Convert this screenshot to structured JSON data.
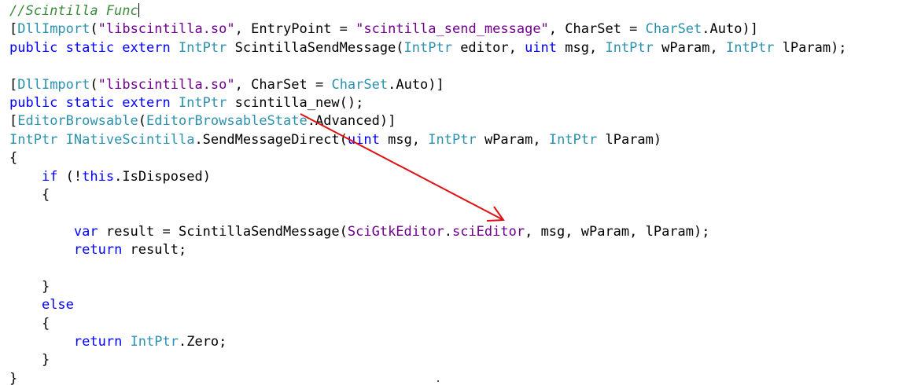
{
  "colors": {
    "comment": "#3a8a3a",
    "keyword": "#0000ff",
    "type": "#2b91af",
    "string": "#a31515",
    "member": "#6f008a",
    "plain": "#000000",
    "annotation_arrow": "#e01010"
  },
  "code_lines": [
    [
      {
        "t": "//Scintilla Func",
        "c": "comment"
      },
      {
        "caret": true
      }
    ],
    [
      {
        "t": "[",
        "c": "plain"
      },
      {
        "t": "DllImport",
        "c": "type"
      },
      {
        "t": "(",
        "c": "plain"
      },
      {
        "t": "\"libscintilla.so\"",
        "c": "member"
      },
      {
        "t": ", EntryPoint = ",
        "c": "plain"
      },
      {
        "t": "\"scintilla_send_message\"",
        "c": "member"
      },
      {
        "t": ", CharSet = ",
        "c": "plain"
      },
      {
        "t": "CharSet",
        "c": "type"
      },
      {
        "t": ".Auto)]",
        "c": "plain"
      }
    ],
    [
      {
        "t": "public static extern ",
        "c": "keyword"
      },
      {
        "t": "IntPtr",
        "c": "type"
      },
      {
        "t": " ScintillaSendMessage(",
        "c": "plain"
      },
      {
        "t": "IntPtr",
        "c": "type"
      },
      {
        "t": " editor, ",
        "c": "plain"
      },
      {
        "t": "uint",
        "c": "keyword"
      },
      {
        "t": " msg, ",
        "c": "plain"
      },
      {
        "t": "IntPtr",
        "c": "type"
      },
      {
        "t": " wParam, ",
        "c": "plain"
      },
      {
        "t": "IntPtr",
        "c": "type"
      },
      {
        "t": " lParam);",
        "c": "plain"
      }
    ],
    [
      {
        "t": "",
        "c": "plain"
      }
    ],
    [
      {
        "t": "[",
        "c": "plain"
      },
      {
        "t": "DllImport",
        "c": "type"
      },
      {
        "t": "(",
        "c": "plain"
      },
      {
        "t": "\"libscintilla.so\"",
        "c": "member"
      },
      {
        "t": ", CharSet = ",
        "c": "plain"
      },
      {
        "t": "CharSet",
        "c": "type"
      },
      {
        "t": ".Auto)]",
        "c": "plain"
      }
    ],
    [
      {
        "t": "public static extern ",
        "c": "keyword"
      },
      {
        "t": "IntPtr",
        "c": "type"
      },
      {
        "t": " scintilla_new();",
        "c": "plain"
      }
    ],
    [
      {
        "t": "[",
        "c": "plain"
      },
      {
        "t": "EditorBrowsable",
        "c": "type"
      },
      {
        "t": "(",
        "c": "plain"
      },
      {
        "t": "EditorBrowsableState",
        "c": "type"
      },
      {
        "t": ".Advanced)]",
        "c": "plain"
      }
    ],
    [
      {
        "t": "IntPtr",
        "c": "type"
      },
      {
        "t": " ",
        "c": "plain"
      },
      {
        "t": "INativeScintilla",
        "c": "type"
      },
      {
        "t": ".SendMessageDirect(",
        "c": "plain"
      },
      {
        "t": "uint",
        "c": "keyword"
      },
      {
        "t": " msg, ",
        "c": "plain"
      },
      {
        "t": "IntPtr",
        "c": "type"
      },
      {
        "t": " wParam, ",
        "c": "plain"
      },
      {
        "t": "IntPtr",
        "c": "type"
      },
      {
        "t": " lParam)",
        "c": "plain"
      }
    ],
    [
      {
        "t": "{",
        "c": "plain"
      }
    ],
    [
      {
        "t": "    ",
        "c": "plain"
      },
      {
        "t": "if",
        "c": "keyword"
      },
      {
        "t": " (!",
        "c": "plain"
      },
      {
        "t": "this",
        "c": "keyword"
      },
      {
        "t": ".IsDisposed)",
        "c": "plain"
      }
    ],
    [
      {
        "t": "    {",
        "c": "plain"
      }
    ],
    [
      {
        "t": "",
        "c": "plain"
      }
    ],
    [
      {
        "t": "        ",
        "c": "plain"
      },
      {
        "t": "var",
        "c": "keyword"
      },
      {
        "t": " result = ScintillaSendMessage(",
        "c": "plain"
      },
      {
        "t": "SciGtkEditor",
        "c": "member"
      },
      {
        "t": ".",
        "c": "plain"
      },
      {
        "t": "sciEditor",
        "c": "member"
      },
      {
        "t": ", msg, wParam, lParam);",
        "c": "plain"
      }
    ],
    [
      {
        "t": "        ",
        "c": "plain"
      },
      {
        "t": "return",
        "c": "keyword"
      },
      {
        "t": " result;",
        "c": "plain"
      }
    ],
    [
      {
        "t": "",
        "c": "plain"
      }
    ],
    [
      {
        "t": "    }",
        "c": "plain"
      }
    ],
    [
      {
        "t": "    ",
        "c": "plain"
      },
      {
        "t": "else",
        "c": "keyword"
      }
    ],
    [
      {
        "t": "    {",
        "c": "plain"
      }
    ],
    [
      {
        "t": "        ",
        "c": "plain"
      },
      {
        "t": "return",
        "c": "keyword"
      },
      {
        "t": " ",
        "c": "plain"
      },
      {
        "t": "IntPtr",
        "c": "type"
      },
      {
        "t": ".Zero;",
        "c": "plain"
      }
    ],
    [
      {
        "t": "    }",
        "c": "plain"
      }
    ],
    [
      {
        "t": "}",
        "c": "plain"
      }
    ]
  ]
}
